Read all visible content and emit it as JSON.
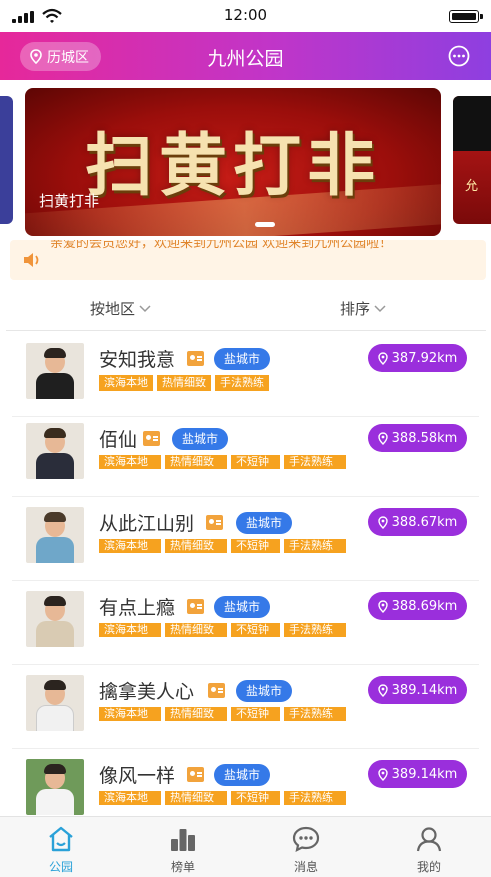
{
  "status_bar": {
    "time": "12:00"
  },
  "header": {
    "location": "历城区",
    "title": "九州公园"
  },
  "banner": {
    "big_text": "扫黄打非",
    "caption": "扫黄打非",
    "peek_right_text": "允"
  },
  "notice": {
    "text": "亲爱的会员您好，欢迎来到九州公园 欢迎来到九州公园啦！"
  },
  "filter": {
    "area_label": "按地区",
    "sort_label": "排序"
  },
  "list": [
    {
      "name": "安知我意",
      "city": "盐城市",
      "distance": "387.92km",
      "tags": [
        "滨海本地",
        "热情细致",
        "手法熟练"
      ]
    },
    {
      "name": "佰仙",
      "city": "盐城市",
      "distance": "388.58km",
      "tags": [
        "滨海本地",
        "热情细致",
        "不短钟",
        "手法熟练"
      ]
    },
    {
      "name": "从此江山别",
      "city": "盐城市",
      "distance": "388.67km",
      "tags": [
        "滨海本地",
        "热情细致",
        "不短钟",
        "手法熟练"
      ]
    },
    {
      "name": "有点上瘾",
      "city": "盐城市",
      "distance": "388.69km",
      "tags": [
        "滨海本地",
        "热情细致",
        "不短钟",
        "手法熟练"
      ]
    },
    {
      "name": "擒拿美人心",
      "city": "盐城市",
      "distance": "389.14km",
      "tags": [
        "滨海本地",
        "热情细致",
        "不短钟",
        "手法熟练"
      ]
    },
    {
      "name": "像风一样",
      "city": "盐城市",
      "distance": "389.14km",
      "tags": [
        "滨海本地",
        "热情细致",
        "不短钟",
        "手法熟练"
      ]
    }
  ],
  "tabbar": [
    {
      "label": "公园",
      "icon": "home-icon",
      "active": true
    },
    {
      "label": "榜单",
      "icon": "ranking-icon",
      "active": false
    },
    {
      "label": "消息",
      "icon": "message-icon",
      "active": false
    },
    {
      "label": "我的",
      "icon": "profile-icon",
      "active": false
    }
  ],
  "colors": {
    "header_start": "#e6289a",
    "header_end": "#8e3fe0",
    "distance_pill": "#9a2fdc",
    "city_pill": "#3579e8",
    "tag": "#f6a21f",
    "active_tab": "#2aa1d8"
  }
}
